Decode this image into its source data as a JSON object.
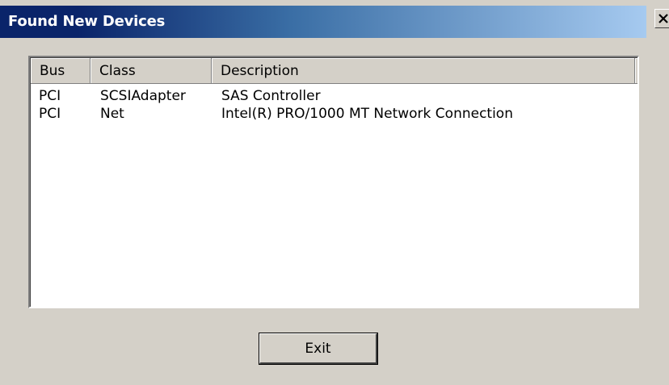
{
  "window": {
    "title": "Found New Devices",
    "close_icon": "close-icon"
  },
  "listview": {
    "columns": [
      {
        "label": "Bus"
      },
      {
        "label": "Class"
      },
      {
        "label": "Description"
      }
    ],
    "rows": [
      {
        "bus": "PCI",
        "class": "SCSIAdapter",
        "description": "SAS Controller"
      },
      {
        "bus": "PCI",
        "class": "Net",
        "description": "Intel(R) PRO/1000 MT Network Connection"
      }
    ]
  },
  "buttons": {
    "exit_label": "Exit"
  },
  "colors": {
    "titlebar_start": "#0a246a",
    "titlebar_end": "#a6caf0",
    "face": "#d4d0c8"
  }
}
